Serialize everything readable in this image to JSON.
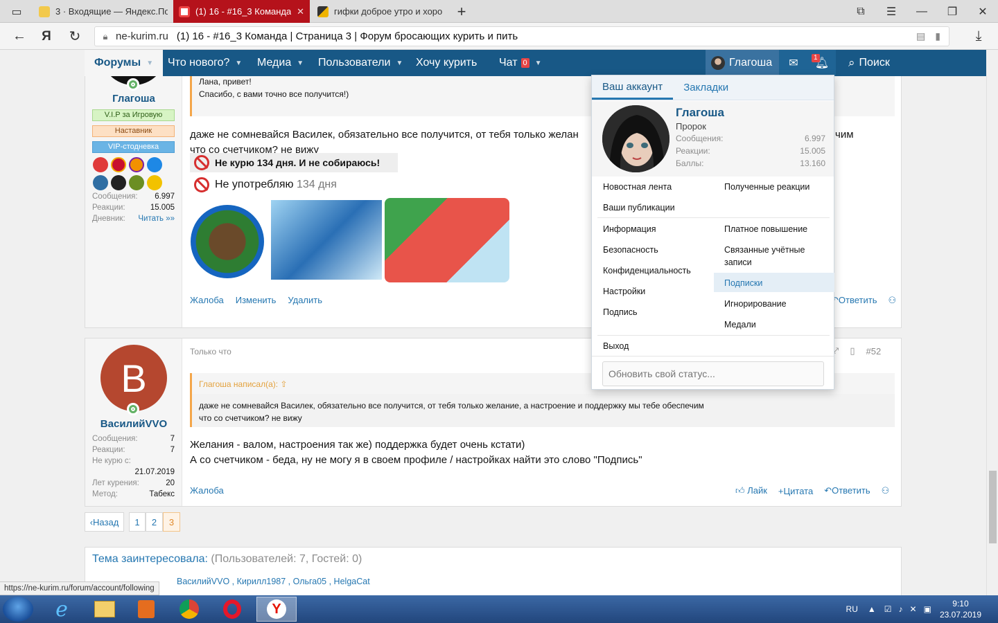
{
  "browser": {
    "tabs": [
      {
        "title": "3 · Входящие — Яндекс.По",
        "active": false
      },
      {
        "title": "(1) 16 - #16_3 Команда",
        "active": true
      },
      {
        "title": "гифки доброе утро и хоро",
        "active": false
      }
    ],
    "new_tab": "+",
    "address": {
      "domain": "ne-kurim.ru",
      "title": "(1) 16 - #16_3 Команда | Страница 3 | Форум бросающих курить и пить"
    },
    "status_url": "https://ne-kurim.ru/forum/account/following"
  },
  "nav": {
    "forums": "Форумы",
    "whats_new": "Что нового?",
    "media": "Медиа",
    "members": "Пользователи",
    "want_smoke": "Хочу курить",
    "chat": "Чат",
    "chat_count": "0",
    "user": "Глагоша",
    "alerts_count": "1",
    "search": "Поиск"
  },
  "post1": {
    "username": "Глагоша",
    "banners": [
      {
        "label": "V.I.P за Игровую",
        "bg": "#d7f4c4",
        "border": "#a8d88e",
        "color": "#2d5e16"
      },
      {
        "label": "Наставник",
        "bg": "#fde0c4",
        "border": "#f3b277",
        "color": "#8a4a12"
      },
      {
        "label": "VIP-стодневка",
        "bg": "#6ab4e5",
        "border": "#4f9ed4",
        "color": "#ffffff"
      }
    ],
    "stats": [
      {
        "label": "Сообщения:",
        "value": "6.997"
      },
      {
        "label": "Реакции:",
        "value": "15.005"
      },
      {
        "label": "Дневник:",
        "value": "Читать »»"
      }
    ],
    "quote_lines": [
      "Лана, привет!",
      "Спасибо, с вами точно все получится!)"
    ],
    "text_line1": "даже не сомневайся Василек, обязательно все получится, от тебя только желан",
    "text_line1_tail": "чим",
    "text_line2": "что со счетчиком? не вижу",
    "sig_banner": "Не курю 134 дня. И не собираюсь!",
    "sig_line_a": "Не употребляю",
    "sig_line_b": "134 дня",
    "actions": [
      "Жалоба",
      "Изменить",
      "Удалить"
    ],
    "reply": "Ответить"
  },
  "post2": {
    "avatar_letter": "В",
    "avatar_color": "#b5472f",
    "username": "ВасилийVVO",
    "stats": [
      {
        "label": "Сообщения:",
        "value": "7"
      },
      {
        "label": "Реакции:",
        "value": "7"
      }
    ],
    "quit_label": "Не курю с:",
    "quit_value": "21.07.2019",
    "years_label": "Лет курения:",
    "years_value": "20",
    "method_label": "Метод:",
    "method_value": "Табекс",
    "time": "Только что",
    "post_no": "#52",
    "quote_author": "Глагоша написал(а):",
    "quote_lines": [
      "даже не сомневайся Василек, обязательно все получится, от тебя только желание, а настроение и поддержку мы тебе обеспечим",
      "что со счетчиком? не вижу"
    ],
    "text_lines": [
      "Желания - валом, настроения так же) поддержка будет очень кстати)",
      "А со счетчиком - беда, ну не могу я в своем профиле / настройках найти это слово \"Подпись\""
    ],
    "report": "Жалоба",
    "like": "Лайк",
    "quote": "Цитата",
    "reply": "Ответить"
  },
  "pager": {
    "prev": "Назад",
    "pages": [
      "1",
      "2",
      "3"
    ],
    "current": "3"
  },
  "watchers": {
    "title": "Тема заинтересовала:",
    "counts": "(Пользователей: 7, Гостей: 0)",
    "names": "ВасилийVVO , Кирилл1987 , Ольга05 , HelgaCat"
  },
  "account_menu": {
    "tab_account": "Ваш аккаунт",
    "tab_bookmarks": "Закладки",
    "name": "Глагоша",
    "title": "Пророк",
    "stats": [
      {
        "label": "Сообщения:",
        "value": "6.997"
      },
      {
        "label": "Реакции:",
        "value": "15.005"
      },
      {
        "label": "Баллы:",
        "value": "13.160"
      }
    ],
    "left_top": [
      "Новостная лента",
      "Ваши публикации"
    ],
    "right_top": [
      "Полученные реакции"
    ],
    "left_mid": [
      "Информация",
      "Безопасность",
      "Конфиденциальность",
      "Настройки",
      "Подпись"
    ],
    "right_mid": [
      "Платное повышение",
      "Связанные учётные",
      "записи",
      "Подписки",
      "Игнорирование",
      "Медали"
    ],
    "logout": "Выход",
    "status_placeholder": "Обновить свой статус..."
  },
  "tray": {
    "lang": "RU",
    "time": "9:10",
    "date": "23.07.2019"
  }
}
